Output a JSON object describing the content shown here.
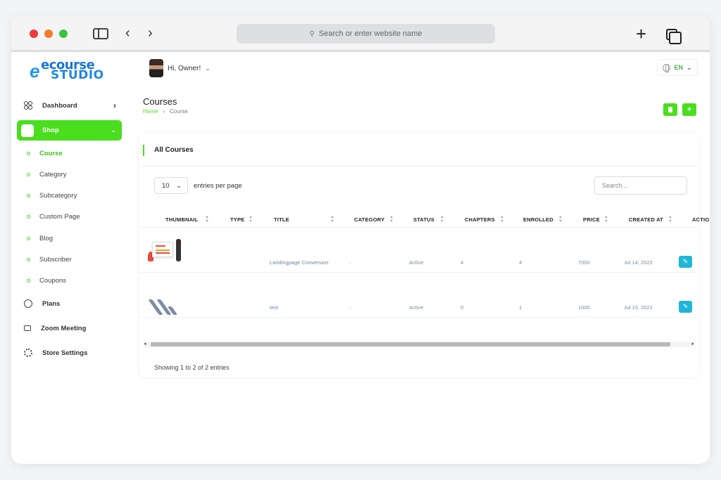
{
  "browser": {
    "url_placeholder": "Search or enter website name",
    "back_glyph": "‹",
    "forward_glyph": "›",
    "new_tab_glyph": "+"
  },
  "brand": {
    "top": "ecourse",
    "bottom": "STUDIO",
    "mark": "e"
  },
  "header": {
    "greeting": "Hi, Owner!",
    "language": "EN"
  },
  "sidebar": {
    "dashboard": "Dashboard",
    "shop": "Shop",
    "shop_children": [
      "Course",
      "Category",
      "Subcategory",
      "Custom Page",
      "Blog",
      "Subscriber",
      "Coupons"
    ],
    "plans": "Plans",
    "zoom": "Zoom Meeting",
    "store_settings": "Store Settings",
    "active_child": "Course"
  },
  "page": {
    "title": "Courses",
    "breadcrumb": {
      "home": "Home",
      "separator": "›",
      "current": "Course"
    },
    "add_glyph": "+"
  },
  "card": {
    "title": "All Courses",
    "per_page_value": "10",
    "per_page_label": "entries per page",
    "search_placeholder": "Search...",
    "columns": [
      "THUMBNAIL",
      "TYPE",
      "TITLE",
      "CATEGORY",
      "STATUS",
      "CHAPTERS",
      "ENROLLED",
      "PRICE",
      "CREATED AT",
      "ACTIO"
    ],
    "rows": [
      {
        "title": "Landingpage Conversion",
        "category": "-",
        "status": "Active",
        "chapters": "4",
        "enrolled": "4",
        "price": "7000",
        "created": "Jul 14, 2022"
      },
      {
        "title": "test",
        "category": "-",
        "status": "Active",
        "chapters": "0",
        "enrolled": "1",
        "price": "1000",
        "created": "Jul 15, 2022"
      }
    ],
    "showing": "Showing 1 to 2 of 2 entries"
  },
  "colors": {
    "accent_green": "#4ade1f",
    "edit_blue": "#1fb6d8",
    "brand_blue": "#1e88e5"
  }
}
